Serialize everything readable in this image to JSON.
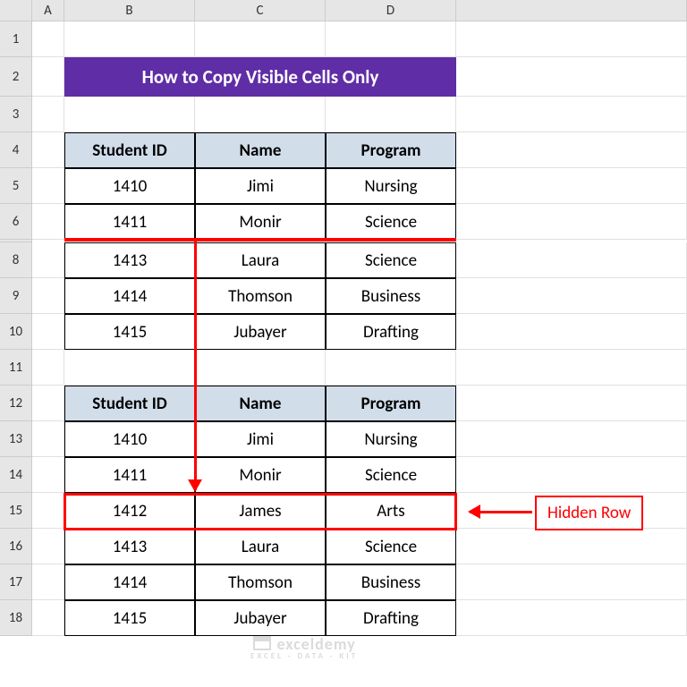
{
  "columns": [
    "A",
    "B",
    "C",
    "D"
  ],
  "row_headers": [
    "1",
    "2",
    "3",
    "4",
    "5",
    "6",
    "8",
    "9",
    "10",
    "11",
    "12",
    "13",
    "14",
    "15",
    "16",
    "17",
    "18"
  ],
  "title": "How to Copy Visible Cells Only",
  "table1": {
    "headers": [
      "Student ID",
      "Name",
      "Program"
    ],
    "rows": [
      [
        "1410",
        "Jimi",
        "Nursing"
      ],
      [
        "1411",
        "Monir",
        "Science"
      ],
      [
        "1413",
        "Laura",
        "Science"
      ],
      [
        "1414",
        "Thomson",
        "Business"
      ],
      [
        "1415",
        "Jubayer",
        "Drafting"
      ]
    ]
  },
  "table2": {
    "headers": [
      "Student ID",
      "Name",
      "Program"
    ],
    "rows": [
      [
        "1410",
        "Jimi",
        "Nursing"
      ],
      [
        "1411",
        "Monir",
        "Science"
      ],
      [
        "1412",
        "James",
        "Arts"
      ],
      [
        "1413",
        "Laura",
        "Science"
      ],
      [
        "1414",
        "Thomson",
        "Business"
      ],
      [
        "1415",
        "Jubayer",
        "Drafting"
      ]
    ]
  },
  "annotation": {
    "label": "Hidden Row"
  },
  "watermark": {
    "main": "exceldemy",
    "sub": "EXCEL · DATA · KIT"
  }
}
